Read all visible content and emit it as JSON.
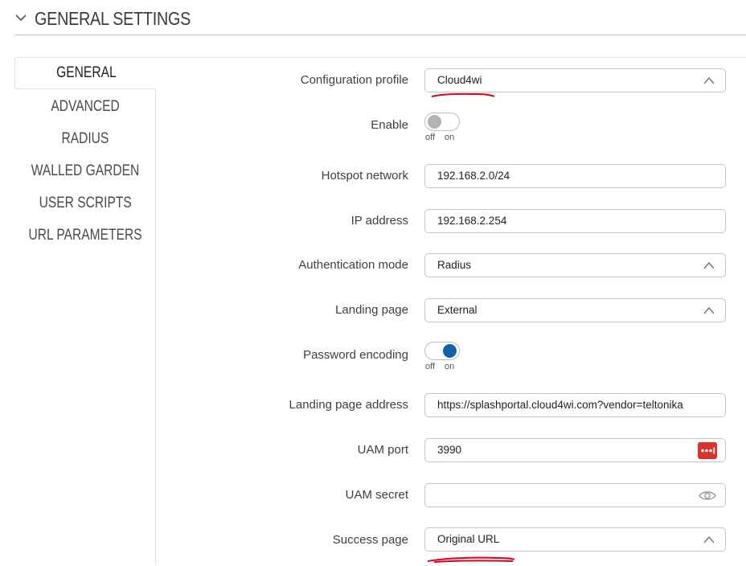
{
  "section": {
    "title": "GENERAL SETTINGS",
    "icon": "chevron-down-icon"
  },
  "tabs": [
    {
      "label": "GENERAL",
      "active": true
    },
    {
      "label": "ADVANCED",
      "active": false
    },
    {
      "label": "RADIUS",
      "active": false
    },
    {
      "label": "WALLED GARDEN",
      "active": false
    },
    {
      "label": "USER SCRIPTS",
      "active": false
    },
    {
      "label": "URL PARAMETERS",
      "active": false
    }
  ],
  "form": {
    "config_profile": {
      "label": "Configuration profile",
      "value": "Cloud4wi"
    },
    "enable": {
      "label": "Enable",
      "state": "off",
      "off_label": "off",
      "on_label": "on"
    },
    "hotspot_network": {
      "label": "Hotspot network",
      "value": "192.168.2.0/24"
    },
    "ip_address": {
      "label": "IP address",
      "value": "192.168.2.254"
    },
    "auth_mode": {
      "label": "Authentication mode",
      "value": "Radius"
    },
    "landing_page": {
      "label": "Landing page",
      "value": "External"
    },
    "password_encoding": {
      "label": "Password encoding",
      "state": "on",
      "off_label": "off",
      "on_label": "on"
    },
    "landing_page_address": {
      "label": "Landing page address",
      "value": "https://splashportal.cloud4wi.com?vendor=teltonika"
    },
    "uam_port": {
      "label": "UAM port",
      "value": "3990",
      "icon": "password-dots-icon"
    },
    "uam_secret": {
      "label": "UAM secret",
      "value": "",
      "icon": "eye-icon"
    },
    "success_page": {
      "label": "Success page",
      "value": "Original URL"
    }
  },
  "colors": {
    "accent": "#1160a8",
    "annotation": "#e0001b",
    "badge": "#d9342b"
  }
}
